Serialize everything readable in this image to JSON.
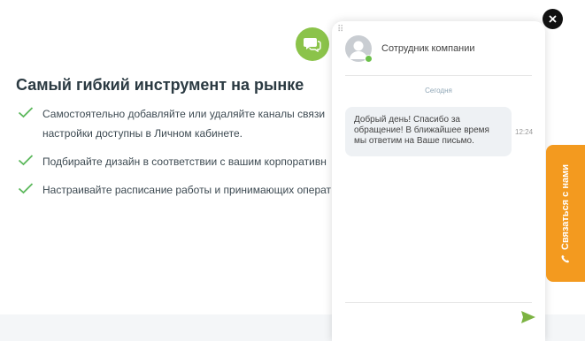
{
  "page": {
    "heading": "Самый гибкий инструмент на рынке",
    "features": [
      {
        "line1": "Самостоятельно добавляйте или удаляйте каналы связи",
        "line2": "настройки доступны в Личном кабинете."
      },
      {
        "line1": "Подбирайте дизайн в соответствии с вашим корпоративн"
      },
      {
        "line1": "Настраивайте расписание работы и принимающих операт"
      }
    ],
    "promo_icon": "chat-bubbles-icon",
    "check_icon": "checkmark-icon"
  },
  "chat": {
    "drag_handle": "⠿",
    "agent_name": "Сотрудник компании",
    "date_separator": "Сегодня",
    "message": {
      "text": "Добрый день! Спасибо за обращение! В ближайшее время мы ответим на Ваше письмо.",
      "time": "12:24"
    },
    "send_icon": "send-icon",
    "close_icon": "close-icon"
  },
  "contact_tab": {
    "label": "Связаться с нами",
    "icon": "phone-icon"
  },
  "colors": {
    "accent_green": "#8bc34a",
    "tab_orange": "#f39a1f",
    "status_online": "#6cc04a"
  }
}
